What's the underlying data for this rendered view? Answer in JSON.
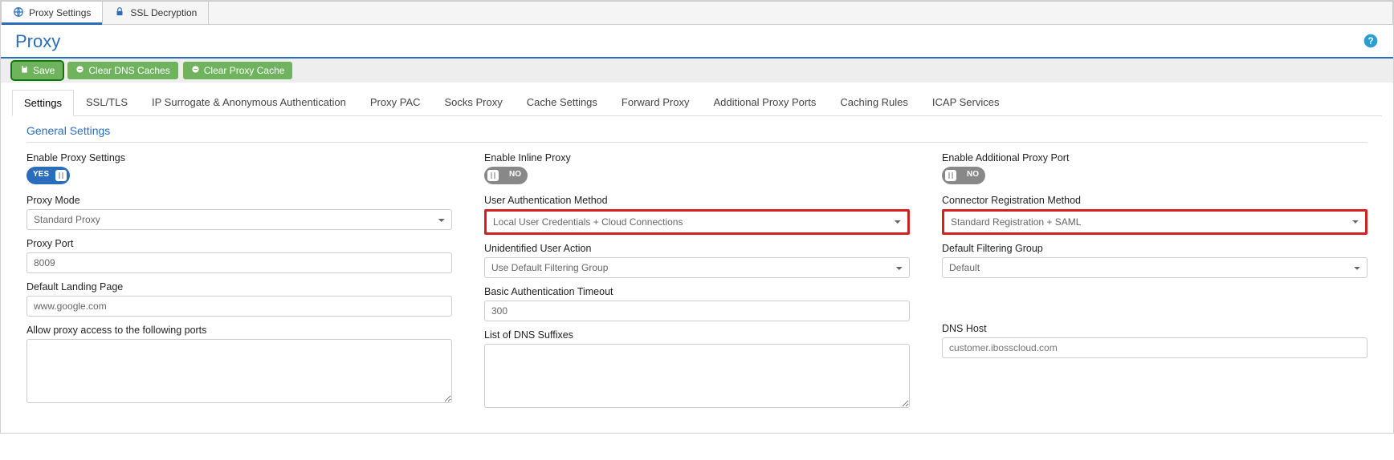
{
  "topTabs": [
    {
      "label": "Proxy Settings",
      "active": true
    },
    {
      "label": "SSL Decryption",
      "active": false
    }
  ],
  "pageTitle": "Proxy",
  "actions": {
    "save": "Save",
    "clearDns": "Clear DNS Caches",
    "clearProxy": "Clear Proxy Cache"
  },
  "subTabs": [
    "Settings",
    "SSL/TLS",
    "IP Surrogate & Anonymous Authentication",
    "Proxy PAC",
    "Socks Proxy",
    "Cache Settings",
    "Forward Proxy",
    "Additional Proxy Ports",
    "Caching Rules",
    "ICAP Services"
  ],
  "activeSubTab": "Settings",
  "sectionTitle": "General Settings",
  "col1": {
    "enableProxy": {
      "label": "Enable Proxy Settings",
      "toggleText": "YES",
      "on": true
    },
    "proxyMode": {
      "label": "Proxy Mode",
      "value": "Standard Proxy"
    },
    "proxyPort": {
      "label": "Proxy Port",
      "value": "8009"
    },
    "landingPage": {
      "label": "Default Landing Page",
      "value": "www.google.com"
    },
    "allowPorts": {
      "label": "Allow proxy access to the following ports",
      "value": ""
    }
  },
  "col2": {
    "enableInline": {
      "label": "Enable Inline Proxy",
      "toggleText": "NO",
      "on": false
    },
    "userAuth": {
      "label": "User Authentication Method",
      "value": "Local User Credentials + Cloud Connections"
    },
    "unidentified": {
      "label": "Unidentified User Action",
      "value": "Use Default Filtering Group"
    },
    "basicAuthTimeout": {
      "label": "Basic Authentication Timeout",
      "value": "300"
    },
    "dnsSuffixes": {
      "label": "List of DNS Suffixes",
      "value": ""
    }
  },
  "col3": {
    "enableAdditional": {
      "label": "Enable Additional Proxy Port",
      "toggleText": "NO",
      "on": false
    },
    "connectorReg": {
      "label": "Connector Registration Method",
      "value": "Standard Registration + SAML"
    },
    "defaultGroup": {
      "label": "Default Filtering Group",
      "value": "Default"
    },
    "dnsHost": {
      "label": "DNS Host",
      "placeholder": "customer.ibosscloud.com",
      "value": ""
    }
  }
}
